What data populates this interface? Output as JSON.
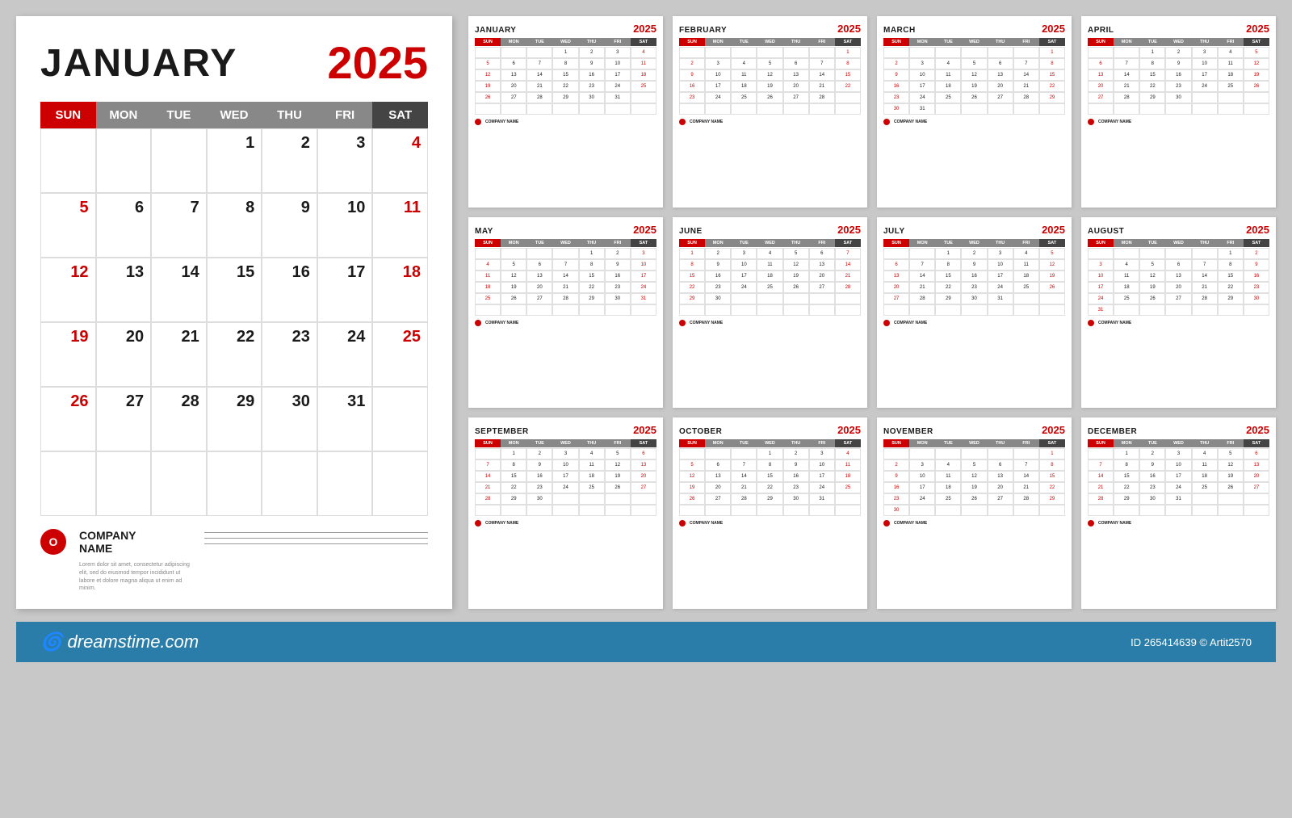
{
  "page": {
    "background_color": "#c8c8c8"
  },
  "large_calendar": {
    "month": "JANUARY",
    "year": "2025",
    "day_headers": [
      "SUN",
      "MON",
      "TUE",
      "WED",
      "THU",
      "FRI",
      "SAT"
    ],
    "weeks": [
      [
        "",
        "",
        "",
        "1",
        "2",
        "3",
        "4"
      ],
      [
        "5",
        "6",
        "7",
        "8",
        "9",
        "10",
        "11"
      ],
      [
        "12",
        "13",
        "14",
        "15",
        "16",
        "17",
        "18"
      ],
      [
        "19",
        "20",
        "21",
        "22",
        "23",
        "24",
        "25"
      ],
      [
        "26",
        "27",
        "28",
        "29",
        "30",
        "31",
        ""
      ],
      [
        "",
        "",
        "",
        "",
        "",
        "",
        ""
      ]
    ],
    "company": {
      "logo_letter": "O",
      "name": "COMPANY\nNAME",
      "desc": "Lorem dolor sit amet, consectetur\nadipiscing elit, sed do eiusmod tempor\nincididunt ut labore et dolore magna\naliqua ut enim ad minim."
    }
  },
  "small_calendars": [
    {
      "month": "JANUARY",
      "year": "2025",
      "weeks": [
        [
          "",
          "",
          "",
          "1",
          "2",
          "3",
          "4"
        ],
        [
          "5",
          "6",
          "7",
          "8",
          "9",
          "10",
          "11"
        ],
        [
          "12",
          "13",
          "14",
          "15",
          "16",
          "17",
          "18"
        ],
        [
          "19",
          "20",
          "21",
          "22",
          "23",
          "24",
          "25"
        ],
        [
          "26",
          "27",
          "28",
          "29",
          "30",
          "31",
          ""
        ],
        [
          "",
          "",
          "",
          "",
          "",
          "",
          ""
        ]
      ]
    },
    {
      "month": "FEBRUARY",
      "year": "2025",
      "weeks": [
        [
          "",
          "",
          "",
          "",
          "",
          "",
          "1"
        ],
        [
          "2",
          "3",
          "4",
          "5",
          "6",
          "7",
          "8"
        ],
        [
          "9",
          "10",
          "11",
          "12",
          "13",
          "14",
          "15"
        ],
        [
          "16",
          "17",
          "18",
          "19",
          "20",
          "21",
          "22"
        ],
        [
          "23",
          "24",
          "25",
          "26",
          "27",
          "28",
          ""
        ],
        [
          "",
          "",
          "",
          "",
          "",
          "",
          ""
        ]
      ]
    },
    {
      "month": "MARCH",
      "year": "2025",
      "weeks": [
        [
          "",
          "",
          "",
          "",
          "",
          "",
          "1"
        ],
        [
          "2",
          "3",
          "4",
          "5",
          "6",
          "7",
          "8"
        ],
        [
          "9",
          "10",
          "11",
          "12",
          "13",
          "14",
          "15"
        ],
        [
          "16",
          "17",
          "18",
          "19",
          "20",
          "21",
          "22"
        ],
        [
          "23",
          "24",
          "25",
          "26",
          "27",
          "28",
          "29"
        ],
        [
          "30",
          "31",
          "",
          "",
          "",
          "",
          ""
        ]
      ]
    },
    {
      "month": "APRIL",
      "year": "2025",
      "weeks": [
        [
          "",
          "",
          "1",
          "2",
          "3",
          "4",
          "5"
        ],
        [
          "6",
          "7",
          "8",
          "9",
          "10",
          "11",
          "12"
        ],
        [
          "13",
          "14",
          "15",
          "16",
          "17",
          "18",
          "19"
        ],
        [
          "20",
          "21",
          "22",
          "23",
          "24",
          "25",
          "26"
        ],
        [
          "27",
          "28",
          "29",
          "30",
          "",
          "",
          ""
        ],
        [
          "",
          "",
          "",
          "",
          "",
          "",
          ""
        ]
      ]
    },
    {
      "month": "MAY",
      "year": "2025",
      "weeks": [
        [
          "",
          "",
          "",
          "",
          "1",
          "2",
          "3"
        ],
        [
          "4",
          "5",
          "6",
          "7",
          "8",
          "9",
          "10"
        ],
        [
          "11",
          "12",
          "13",
          "14",
          "15",
          "16",
          "17"
        ],
        [
          "18",
          "19",
          "20",
          "21",
          "22",
          "23",
          "24"
        ],
        [
          "25",
          "26",
          "27",
          "28",
          "29",
          "30",
          "31"
        ],
        [
          "",
          "",
          "",
          "",
          "",
          "",
          ""
        ]
      ]
    },
    {
      "month": "JUNE",
      "year": "2025",
      "weeks": [
        [
          "1",
          "2",
          "3",
          "4",
          "5",
          "6",
          "7"
        ],
        [
          "8",
          "9",
          "10",
          "11",
          "12",
          "13",
          "14"
        ],
        [
          "15",
          "16",
          "17",
          "18",
          "19",
          "20",
          "21"
        ],
        [
          "22",
          "23",
          "24",
          "25",
          "26",
          "27",
          "28"
        ],
        [
          "29",
          "30",
          "",
          "",
          "",
          "",
          ""
        ],
        [
          "",
          "",
          "",
          "",
          "",
          "",
          ""
        ]
      ]
    },
    {
      "month": "JULY",
      "year": "2025",
      "weeks": [
        [
          "",
          "",
          "1",
          "2",
          "3",
          "4",
          "5"
        ],
        [
          "6",
          "7",
          "8",
          "9",
          "10",
          "11",
          "12"
        ],
        [
          "13",
          "14",
          "15",
          "16",
          "17",
          "18",
          "19"
        ],
        [
          "20",
          "21",
          "22",
          "23",
          "24",
          "25",
          "26"
        ],
        [
          "27",
          "28",
          "29",
          "30",
          "31",
          "",
          ""
        ],
        [
          "",
          "",
          "",
          "",
          "",
          "",
          ""
        ]
      ]
    },
    {
      "month": "AUGUST",
      "year": "2025",
      "weeks": [
        [
          "",
          "",
          "",
          "",
          "",
          "1",
          "2"
        ],
        [
          "3",
          "4",
          "5",
          "6",
          "7",
          "8",
          "9"
        ],
        [
          "10",
          "11",
          "12",
          "13",
          "14",
          "15",
          "16"
        ],
        [
          "17",
          "18",
          "19",
          "20",
          "21",
          "22",
          "23"
        ],
        [
          "24",
          "25",
          "26",
          "27",
          "28",
          "29",
          "30"
        ],
        [
          "31",
          "",
          "",
          "",
          "",
          "",
          ""
        ]
      ]
    },
    {
      "month": "SEPTEMBER",
      "year": "2025",
      "weeks": [
        [
          "",
          "1",
          "2",
          "3",
          "4",
          "5",
          "6"
        ],
        [
          "7",
          "8",
          "9",
          "10",
          "11",
          "12",
          "13"
        ],
        [
          "14",
          "15",
          "16",
          "17",
          "18",
          "19",
          "20"
        ],
        [
          "21",
          "22",
          "23",
          "24",
          "25",
          "26",
          "27"
        ],
        [
          "28",
          "29",
          "30",
          "",
          "",
          "",
          ""
        ],
        [
          "",
          "",
          "",
          "",
          "",
          "",
          ""
        ]
      ]
    },
    {
      "month": "OCTOBER",
      "year": "2025",
      "weeks": [
        [
          "",
          "",
          "",
          "1",
          "2",
          "3",
          "4"
        ],
        [
          "5",
          "6",
          "7",
          "8",
          "9",
          "10",
          "11"
        ],
        [
          "12",
          "13",
          "14",
          "15",
          "16",
          "17",
          "18"
        ],
        [
          "19",
          "20",
          "21",
          "22",
          "23",
          "24",
          "25"
        ],
        [
          "26",
          "27",
          "28",
          "29",
          "30",
          "31",
          ""
        ],
        [
          "",
          "",
          "",
          "",
          "",
          "",
          ""
        ]
      ]
    },
    {
      "month": "NOVEMBER",
      "year": "2025",
      "weeks": [
        [
          "",
          "",
          "",
          "",
          "",
          "",
          "1"
        ],
        [
          "2",
          "3",
          "4",
          "5",
          "6",
          "7",
          "8"
        ],
        [
          "9",
          "10",
          "11",
          "12",
          "13",
          "14",
          "15"
        ],
        [
          "16",
          "17",
          "18",
          "19",
          "20",
          "21",
          "22"
        ],
        [
          "23",
          "24",
          "25",
          "26",
          "27",
          "28",
          "29"
        ],
        [
          "30",
          "",
          "",
          "",
          "",
          "",
          ""
        ]
      ]
    },
    {
      "month": "DECEMBER",
      "year": "2025",
      "weeks": [
        [
          "",
          "1",
          "2",
          "3",
          "4",
          "5",
          "6"
        ],
        [
          "7",
          "8",
          "9",
          "10",
          "11",
          "12",
          "13"
        ],
        [
          "14",
          "15",
          "16",
          "17",
          "18",
          "19",
          "20"
        ],
        [
          "21",
          "22",
          "23",
          "24",
          "25",
          "26",
          "27"
        ],
        [
          "28",
          "29",
          "30",
          "31",
          "",
          "",
          ""
        ],
        [
          "",
          "",
          "",
          "",
          "",
          "",
          ""
        ]
      ]
    }
  ],
  "bottom_bar": {
    "dreamstime": "dreamstime.com",
    "stock_id": "265414639",
    "author": "Artit2570"
  },
  "day_headers_short": [
    "SUN",
    "MON",
    "TUE",
    "WED",
    "THU",
    "FRI",
    "SAT"
  ]
}
